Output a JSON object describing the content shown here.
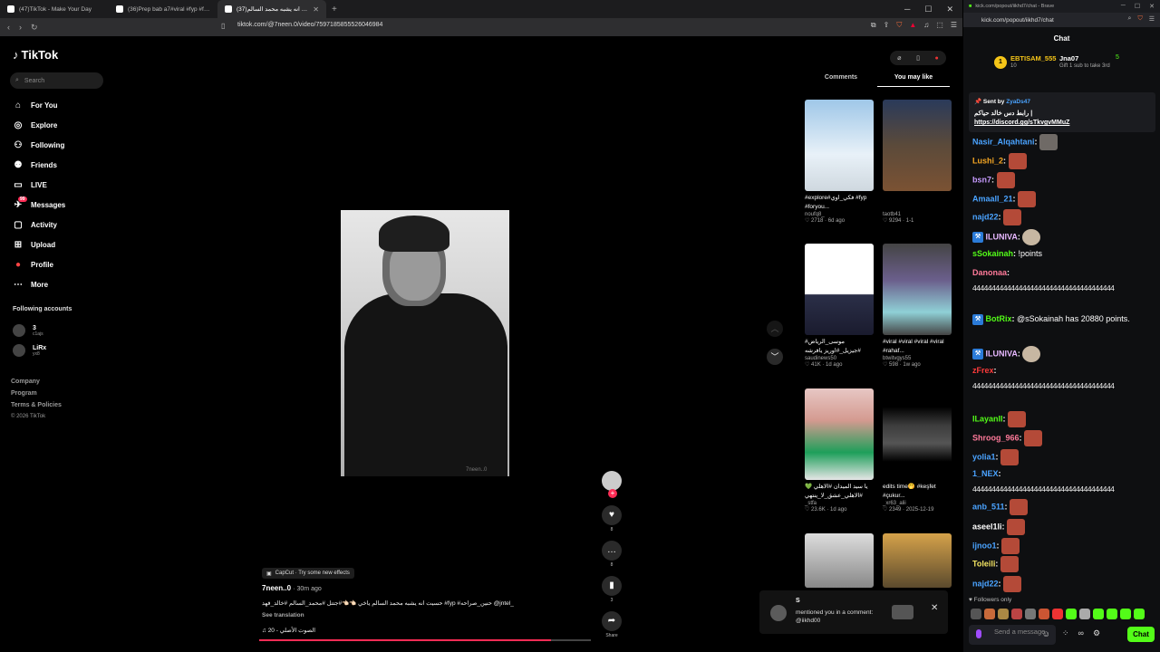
{
  "browser": {
    "tabs": [
      {
        "title": "(47)TikTok - Make Your Day",
        "active": false
      },
      {
        "title": "(36)Prep bab a7#viral #fyp #foryou #",
        "active": false
      },
      {
        "title": "(37)حسيت انه يشبه محمد السالم",
        "active": true
      }
    ],
    "url": "tiktok.com/@7neen.0/video/7597185855526046984"
  },
  "tiktok": {
    "logo": "TikTok",
    "search_placeholder": "Search",
    "nav": [
      {
        "label": "For You",
        "icon": "home-icon"
      },
      {
        "label": "Explore",
        "icon": "compass-icon"
      },
      {
        "label": "Following",
        "icon": "following-icon"
      },
      {
        "label": "Friends",
        "icon": "friends-icon"
      },
      {
        "label": "LIVE",
        "icon": "live-icon"
      },
      {
        "label": "Messages",
        "icon": "messages-icon",
        "badge": "99"
      },
      {
        "label": "Activity",
        "icon": "activity-icon"
      },
      {
        "label": "Upload",
        "icon": "upload-icon"
      },
      {
        "label": "Profile",
        "icon": "profile-icon"
      },
      {
        "label": "More",
        "icon": "more-icon"
      }
    ],
    "following_title": "Following accounts",
    "following": [
      {
        "name": "3",
        "sub": "c1ajs"
      },
      {
        "name": "LiRx",
        "sub": "yx8"
      }
    ],
    "footer": [
      "Company",
      "Program",
      "Terms & Policies",
      "© 2026 TikTok"
    ],
    "video": {
      "watermark": "7neen..0",
      "effect": "CapCut · Try some new effects",
      "author": "7neen..0",
      "time": "· 30m ago",
      "caption": "حسيت انه يشبه محمد السالم ياخي 👈🏻👈🏻#جتتل #محمد_السالم #خالد_فهد #fyp #حنين_صراحه @jntel_",
      "see_translation": "See translation",
      "sound": "♫ الصوت الأصلي - 20",
      "progress_percent": 88
    },
    "actions": [
      {
        "name": "like",
        "count": "8"
      },
      {
        "name": "comment",
        "count": "8"
      },
      {
        "name": "save",
        "count": "3"
      },
      {
        "name": "share",
        "count": "Share"
      }
    ],
    "right_tabs": [
      "Comments",
      "You may like"
    ],
    "cards": [
      {
        "caption": "#explore#فكي_اوي #fyp #foryou...",
        "author": "noufq8_",
        "meta": "♡ 2718 · 6d ago"
      },
      {
        "caption": "",
        "author": "taotb41",
        "meta": "♡ 9294 · 1-1"
      },
      {
        "caption": "#موسى_الرياض #جيزيل_#اوريز يافرشه",
        "author": "saudinews50",
        "meta": "♡ 41K · 1d ago"
      },
      {
        "caption": "#viral #viral #viral #viral #rahaf...",
        "author": "btwitvgys55",
        "meta": "♡ 598 · 1w ago"
      },
      {
        "caption": "💚 يا سيد الميدان #الاهلي #الاهلي_عشق_لا_ينتهي",
        "author": "_stfa",
        "meta": "♡ 23.6K · 1d ago"
      },
      {
        "caption": "edits time🤭 #keşfet #çukur...",
        "author": "_xr63_alii",
        "meta": "♡ 2349 · 2025-12-19"
      }
    ],
    "notification": {
      "sender": "S",
      "message": "mentioned you in a comment: @iikhd00"
    }
  },
  "kick": {
    "window_title": "kick.com/popout/iikhd7/chat - Brave",
    "url": "kick.com/popout/iikhd7/chat",
    "title": "Chat",
    "gifter1": {
      "name": "EBTISAM_555",
      "count": "10"
    },
    "gifter2": {
      "name": "Jna07",
      "sub": "Gift 1 sub to take 3rd",
      "count": "5"
    },
    "pinned": {
      "sent_by": "Sent by",
      "user": "ZyaDs47",
      "line1": "رابط دس خالد حياكم |",
      "link": "https://discord.gg/sTkvgvMMuZ"
    },
    "messages": [
      {
        "user": "Nasir_Alqahtani",
        "text": "",
        "color": "#4aa3ff"
      },
      {
        "user": "Lushi_2",
        "text": "",
        "color": "#f5a623"
      },
      {
        "user": "bsn7",
        "text": "",
        "color": "#c79bff"
      },
      {
        "user": "Amaall_21",
        "text": "",
        "color": "#4aa3ff"
      },
      {
        "user": "najd22",
        "text": "",
        "color": "#4aa3ff"
      },
      {
        "user": "ILUNIVA",
        "text": "",
        "color": "#e7b8ff"
      },
      {
        "user": "sSokainah",
        "text": "!points",
        "color": "#53fc18"
      },
      {
        "user": "Danonaa",
        "text": "",
        "color": "#ff7a9a"
      },
      {
        "user": "BotRix",
        "text": "@sSokainah has 20880 points.",
        "color": "#53fc18"
      },
      {
        "user": "ILUNIVA",
        "text": "",
        "color": "#e7b8ff"
      },
      {
        "user": "zFrex",
        "text": "",
        "color": "#ff3b3b"
      },
      {
        "user": "ILayanII",
        "text": "",
        "color": "#53fc18"
      },
      {
        "user": "Shroog_966",
        "text": "",
        "color": "#ff7a9a"
      },
      {
        "user": "yolia1",
        "text": "",
        "color": "#4aa3ff"
      },
      {
        "user": "1_NEX",
        "text": "",
        "color": "#4aa3ff"
      },
      {
        "user": "anb_511",
        "text": "",
        "color": "#4aa3ff"
      },
      {
        "user": "aseel1li",
        "text": "",
        "color": "#fff"
      },
      {
        "user": "ijnoo1",
        "text": "",
        "color": "#4aa3ff"
      },
      {
        "user": "Toleili",
        "text": "",
        "color": "#f5e663"
      },
      {
        "user": "najd22",
        "text": "",
        "color": "#4aa3ff"
      }
    ],
    "spam_line": "4444444444444444444444444444444444444",
    "followers_only": "Followers only",
    "send_placeholder": "Send a message",
    "chat_button": "Chat"
  }
}
